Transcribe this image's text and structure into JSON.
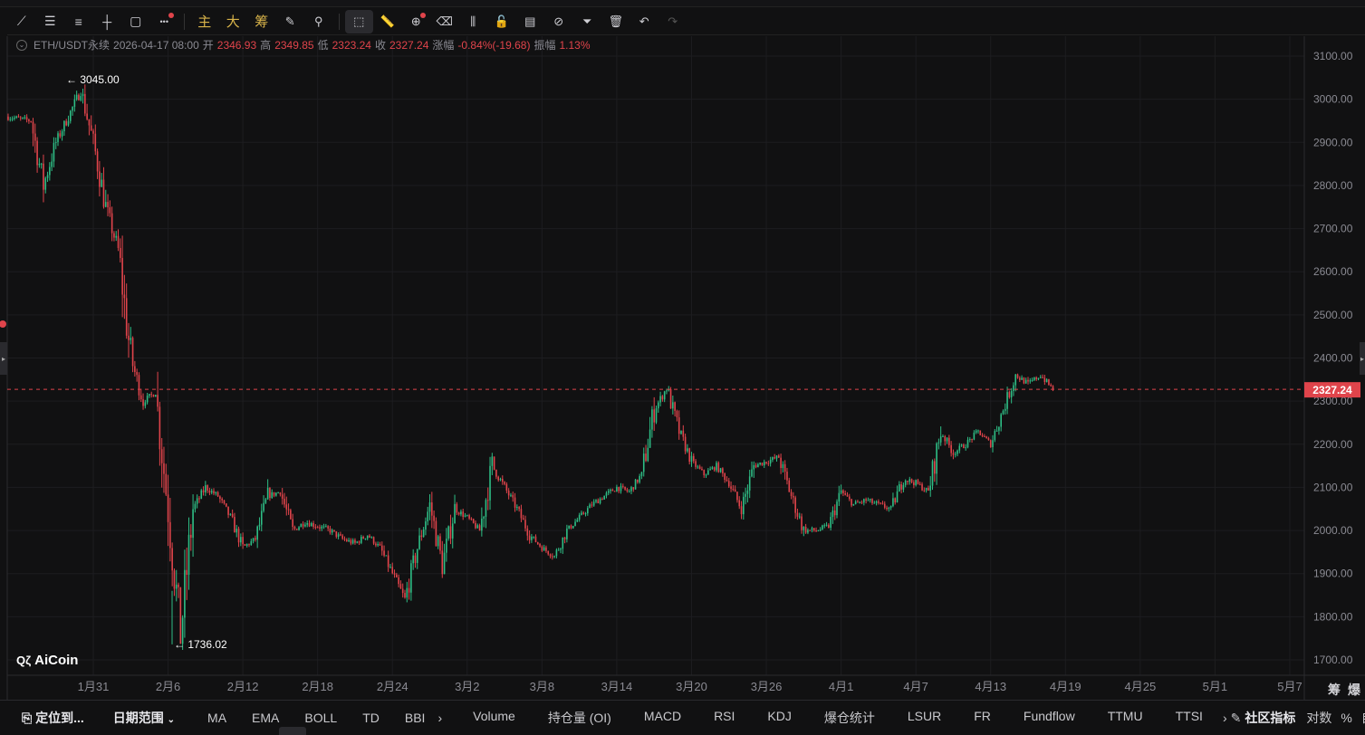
{
  "toolbar": {
    "items": [
      {
        "name": "trend-line-icon",
        "glyph": "⟋"
      },
      {
        "name": "parallel-lines-icon",
        "glyph": "☰"
      },
      {
        "name": "horizontal-lines-icon",
        "glyph": "≡"
      },
      {
        "name": "horizontal-ray-icon",
        "glyph": "┼"
      },
      {
        "name": "rectangle-icon",
        "glyph": "▢"
      },
      {
        "name": "more-tools-icon",
        "glyph": "•••"
      }
    ],
    "gold": [
      "主",
      "大",
      "筹"
    ],
    "tools": [
      {
        "name": "draw-edit-icon",
        "glyph": "✎"
      },
      {
        "name": "magnet-icon",
        "glyph": "⚲"
      },
      {
        "name": "select-mode-icon",
        "glyph": "⬚"
      },
      {
        "name": "ruler-icon",
        "glyph": "📏"
      },
      {
        "name": "zoom-icon",
        "glyph": "⊕"
      },
      {
        "name": "eraser-icon",
        "glyph": "⌫"
      },
      {
        "name": "candles-icon",
        "glyph": "⫼"
      },
      {
        "name": "lock-icon",
        "glyph": "🔓"
      },
      {
        "name": "notes-icon",
        "glyph": "▤"
      },
      {
        "name": "link-icon",
        "glyph": "⊘"
      },
      {
        "name": "filter-icon",
        "glyph": "⏷"
      },
      {
        "name": "trash-icon",
        "glyph": "🗑"
      },
      {
        "name": "undo-icon",
        "glyph": "↶"
      },
      {
        "name": "redo-icon",
        "glyph": "↷"
      }
    ]
  },
  "info": {
    "symbol": "ETH/USDT永续",
    "time": "2026-04-17 08:00",
    "open_label": "开",
    "open": "2346.93",
    "high_label": "高",
    "high": "2349.85",
    "low_label": "低",
    "low": "2323.24",
    "close_label": "收",
    "close": "2327.24",
    "change_label": "涨幅",
    "change": "-0.84%(-19.68)",
    "amp_label": "振幅",
    "amp": "1.13%"
  },
  "colors": {
    "up": "#2ebd85",
    "down": "#e0444b",
    "bg": "#111112",
    "grid": "#1d1d20"
  },
  "chart_data": {
    "type": "candlestick",
    "interval": "4h",
    "ylim": [
      1650,
      3130
    ],
    "yticks": [
      1700,
      1800,
      1900,
      2000,
      2100,
      2200,
      2300,
      2400,
      2500,
      2600,
      2700,
      2800,
      2900,
      3000,
      3100
    ],
    "xticks": [
      "1月31",
      "2月6",
      "2月12",
      "2月18",
      "2月24",
      "3月2",
      "3月8",
      "3月14",
      "3月20",
      "3月26",
      "4月1",
      "4月7",
      "4月13",
      "4月19",
      "4月25",
      "5月1",
      "5月7"
    ],
    "xtick_day_offsets": [
      0,
      6,
      12,
      18,
      24,
      30,
      36,
      42,
      48,
      54,
      60,
      66,
      72,
      78,
      84,
      90,
      96
    ],
    "daily_path_start_offset": -7,
    "daily_close": [
      2960,
      2955,
      2950,
      2800,
      2900,
      2960,
      3020,
      2900,
      2750,
      2650,
      2400,
      2300,
      2320,
      2050,
      1760,
      2050,
      2100,
      2080,
      2030,
      1960,
      1980,
      2080,
      2090,
      2000,
      2020,
      2010,
      2000,
      1980,
      1970,
      1990,
      1960,
      1900,
      1840,
      1960,
      2060,
      1920,
      2050,
      2030,
      2000,
      2150,
      2100,
      2050,
      1990,
      1960,
      1940,
      2000,
      2030,
      2060,
      2080,
      2100,
      2090,
      2130,
      2280,
      2330,
      2230,
      2160,
      2130,
      2150,
      2110,
      2050,
      2150,
      2160,
      2170,
      2080,
      2000,
      2000,
      2010,
      2090,
      2060,
      2070,
      2060,
      2050,
      2120,
      2110,
      2090,
      2230,
      2180,
      2200,
      2230,
      2200,
      2280,
      2360,
      2340,
      2360,
      2327.24
    ],
    "high_marker": "3045.00",
    "low_marker": "1736.02",
    "last_price": "2327.24",
    "axis_right_labels": [
      "筹",
      "爆"
    ]
  },
  "bottom": {
    "locate": "定位到...",
    "date_range": "日期范围",
    "main_indicators": [
      "MA",
      "EMA",
      "BOLL",
      "TD",
      "BBI"
    ],
    "sub_indicators": [
      "Volume",
      "持仓量 (OI)",
      "MACD",
      "RSI",
      "KDJ",
      "爆仓统计",
      "LSUR",
      "FR",
      "Fundflow",
      "TTMU",
      "TTSI"
    ],
    "community": "社区指标",
    "log": "对数",
    "percent": "%",
    "auto": "自动"
  },
  "logo": "AiCoin"
}
